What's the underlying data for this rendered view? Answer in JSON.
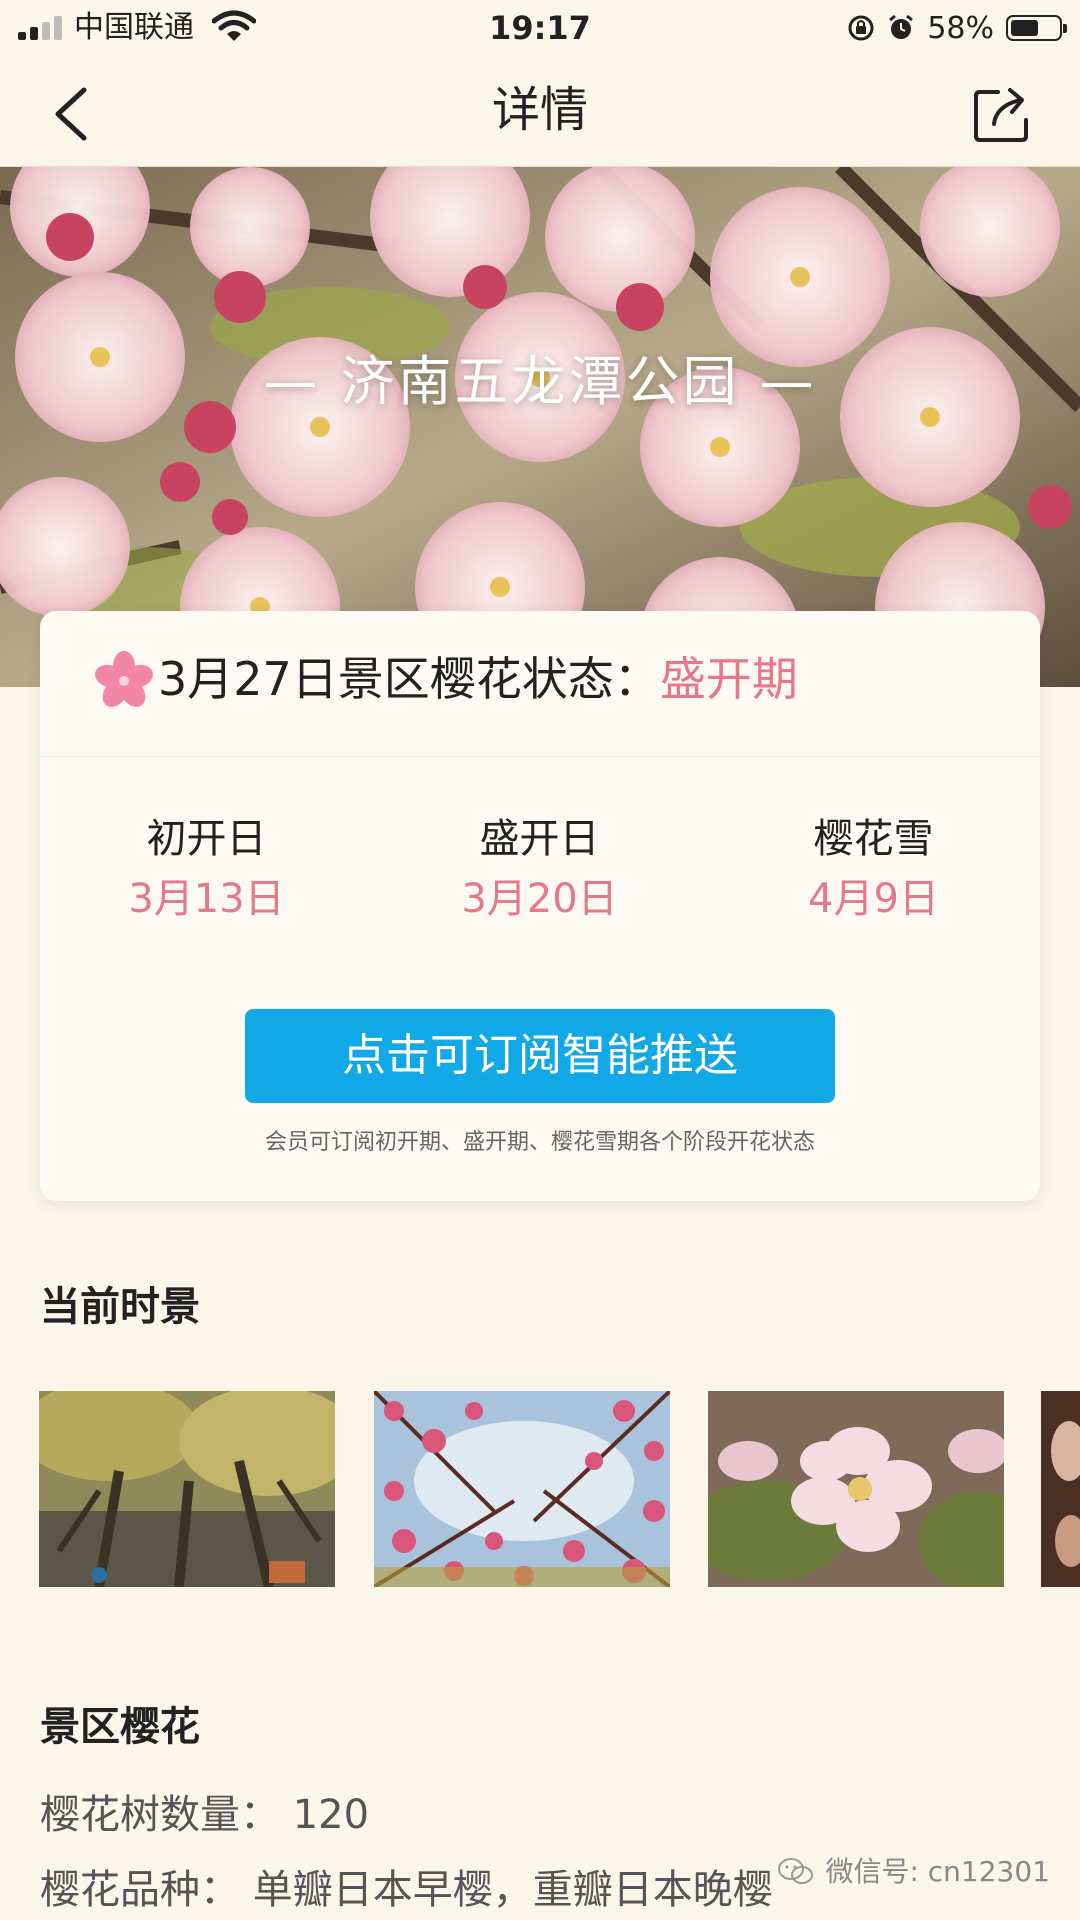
{
  "status_bar": {
    "carrier": "中国联通",
    "time": "19:17",
    "battery_percent": "58%",
    "battery_level": 0.58
  },
  "nav": {
    "title": "详情",
    "back_icon": "chevron-left-icon",
    "share_icon": "share-icon"
  },
  "hero": {
    "title": "— 济南五龙潭公园 —"
  },
  "status_card": {
    "status_label": "3月27日景区樱花状态：",
    "status_value": "盛开期",
    "accent_color": "#e6788a",
    "dates": [
      {
        "label": "初开日",
        "value": "3月13日"
      },
      {
        "label": "盛开日",
        "value": "3月20日"
      },
      {
        "label": "樱花雪",
        "value": "4月9日"
      }
    ],
    "subscribe_button": "点击可订阅智能推送",
    "button_color": "#10a8e6",
    "note": "会员可订阅初开期、盛开期、樱花雪期各个阶段开花状态"
  },
  "current_scenery": {
    "title": "当前时景"
  },
  "scenic_sakura": {
    "title": "景区樱花",
    "tree_count_line": "樱花树数量：  120",
    "varieties_line": "樱花品种：  单瓣日本早樱，重瓣日本晚樱"
  },
  "watermark": {
    "text": "微信号: cn12301"
  }
}
